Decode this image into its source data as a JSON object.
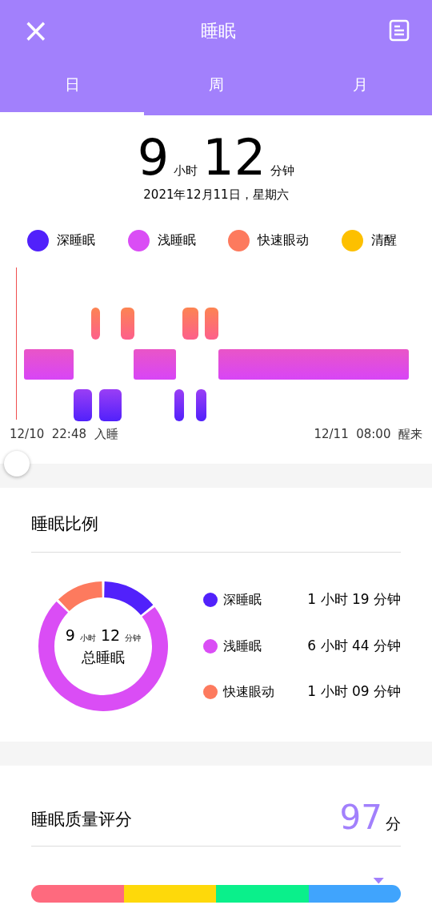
{
  "header": {
    "close": "×",
    "title": "睡眠"
  },
  "tabs": [
    {
      "label": "日",
      "selected": true
    },
    {
      "label": "周",
      "selected": false
    },
    {
      "label": "月",
      "selected": false
    }
  ],
  "summary": {
    "hours": "9",
    "hours_unit": "小时",
    "minutes": "12",
    "minutes_unit": "分钟",
    "date": "2021年12月11日，星期六"
  },
  "legend": [
    {
      "label": "深睡眠",
      "color": "#5121fb"
    },
    {
      "label": "浅睡眠",
      "color": "#da4df5"
    },
    {
      "label": "快速眼动",
      "color": "#fd7a5e"
    },
    {
      "label": "清醒",
      "color": "#fdc000"
    }
  ],
  "timeline": {
    "start": "12/10  22:48  入睡",
    "end": "12/11  08:00  醒来",
    "slider": {
      "level": 0
    }
  },
  "ratio": {
    "title": "睡眠比例",
    "center_hours": "9",
    "center_hours_unit": "小时",
    "center_minutes": "12",
    "center_minutes_unit": "分钟",
    "center_label": "总睡眠",
    "items": [
      {
        "label": "深睡眠",
        "color": "#5121fb",
        "value": "1 小时 19 分钟"
      },
      {
        "label": "浅睡眠",
        "color": "#da4df5",
        "value": "6 小时 44 分钟"
      },
      {
        "label": "快速眼动",
        "color": "#fd7a5e",
        "value": "1 小时 09 分钟"
      }
    ]
  },
  "quality": {
    "title": "睡眠质量评分",
    "score": "97",
    "unit": "分"
  }
}
